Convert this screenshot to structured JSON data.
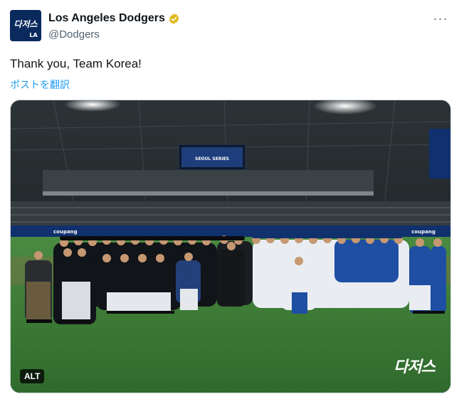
{
  "account": {
    "display_name": "Los Angeles Dodgers",
    "handle": "@Dodgers",
    "avatar_text": "다저스",
    "verified": true,
    "verified_color": "#e2b719"
  },
  "tweet": {
    "text": "Thank you, Team Korea!",
    "translate_label": "ポストを翻訳"
  },
  "menu": {
    "more_label": "···"
  },
  "media": {
    "alt_label": "ALT",
    "watermark": "다저스",
    "scoreboard_text": "SEOUL SERIES",
    "ad_board": "coupang"
  },
  "colors": {
    "link": "#1d9bf0",
    "avatar_bg": "#0a2a5e",
    "field": "#3f7d3a",
    "dodgers_blue": "#1e4fa3"
  }
}
